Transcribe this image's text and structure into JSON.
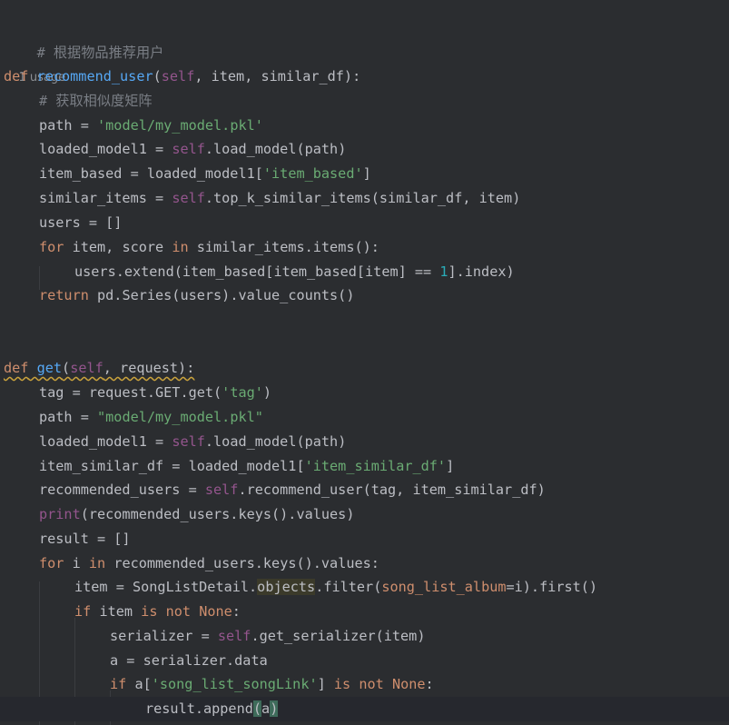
{
  "editor": {
    "colors": {
      "background": "#2b2d30",
      "keyword": "#cf8e6d",
      "function": "#56a8f5",
      "self": "#94558d",
      "string": "#6aab73",
      "number": "#2aacb8",
      "comment": "#7a7e85",
      "text": "#bcbec4"
    },
    "comment_title": "# 根据物品推荐用户",
    "usage_hint": "1 usage",
    "func1": {
      "kw_def": "def",
      "name": "recommend_user",
      "open": "(",
      "self": "self",
      "params_rest": ", item, similar_df):",
      "comment": "# 获取相似度矩阵",
      "l_path_a": "path = ",
      "l_path_str": "'model/my_model.pkl'",
      "l_load_a": "loaded_model1 = ",
      "l_load_self": "self",
      "l_load_b": ".load_model(path)",
      "l_item_a": "item_based = loaded_model1[",
      "l_item_str": "'item_based'",
      "l_item_b": "]",
      "l_sim_a": "similar_items = ",
      "l_sim_self": "self",
      "l_sim_b": ".top_k_similar_items(similar_df, item)",
      "l_users": "users = []",
      "l_for_kw": "for",
      "l_for_a": " item, score ",
      "l_for_in": "in",
      "l_for_b": " similar_items.items():",
      "l_ext_a": "users.extend(item_based[item_based[item] == ",
      "l_ext_num": "1",
      "l_ext_b": "].index)",
      "l_ret_kw": "return",
      "l_ret_b": " pd.Series(users).value_counts()"
    },
    "func2": {
      "kw_def": "def",
      "name": "get",
      "open": "(",
      "self": "self",
      "params_rest": ", request):",
      "l_tag_a": "tag = request.GET.get(",
      "l_tag_str": "'tag'",
      "l_tag_b": ")",
      "l_path_a": "path = ",
      "l_path_str": "\"model/my_model.pkl\"",
      "l_load_a": "loaded_model1 = ",
      "l_load_self": "self",
      "l_load_b": ".load_model(path)",
      "l_isdf_a": "item_similar_df = loaded_model1[",
      "l_isdf_str": "'item_similar_df'",
      "l_isdf_b": "]",
      "l_rec_a": "recommended_users = ",
      "l_rec_self": "self",
      "l_rec_b": ".recommend_user(tag, item_similar_df)",
      "l_print_fn": "print",
      "l_print_b": "(recommended_users.keys().values)",
      "l_result": "result = []",
      "l_for_kw": "for",
      "l_for_a": " i ",
      "l_for_in": "in",
      "l_for_b": " recommended_users.keys().values:",
      "l_item_a": "item = SongListDetail.",
      "l_item_obj": "objects",
      "l_item_b": ".filter(",
      "l_item_kw": "song_list_album",
      "l_item_c": "=i).first()",
      "l_if_kw": "if",
      "l_if_a": " item ",
      "l_if_is": "is not",
      "l_if_none": "None",
      "l_if_b": ":",
      "l_ser_a": "serializer = ",
      "l_ser_self": "self",
      "l_ser_b": ".get_serializer(item)",
      "l_a": "a = serializer.data",
      "l_if2_kw": "if",
      "l_if2_a": " a[",
      "l_if2_str": "'song_list_songLink'",
      "l_if2_b": "] ",
      "l_if2_is": "is not",
      "l_if2_none": "None",
      "l_if2_c": ":",
      "l_app_a": "result.append",
      "l_app_open": "(",
      "l_app_mid": "a",
      "l_app_close": ")"
    }
  }
}
